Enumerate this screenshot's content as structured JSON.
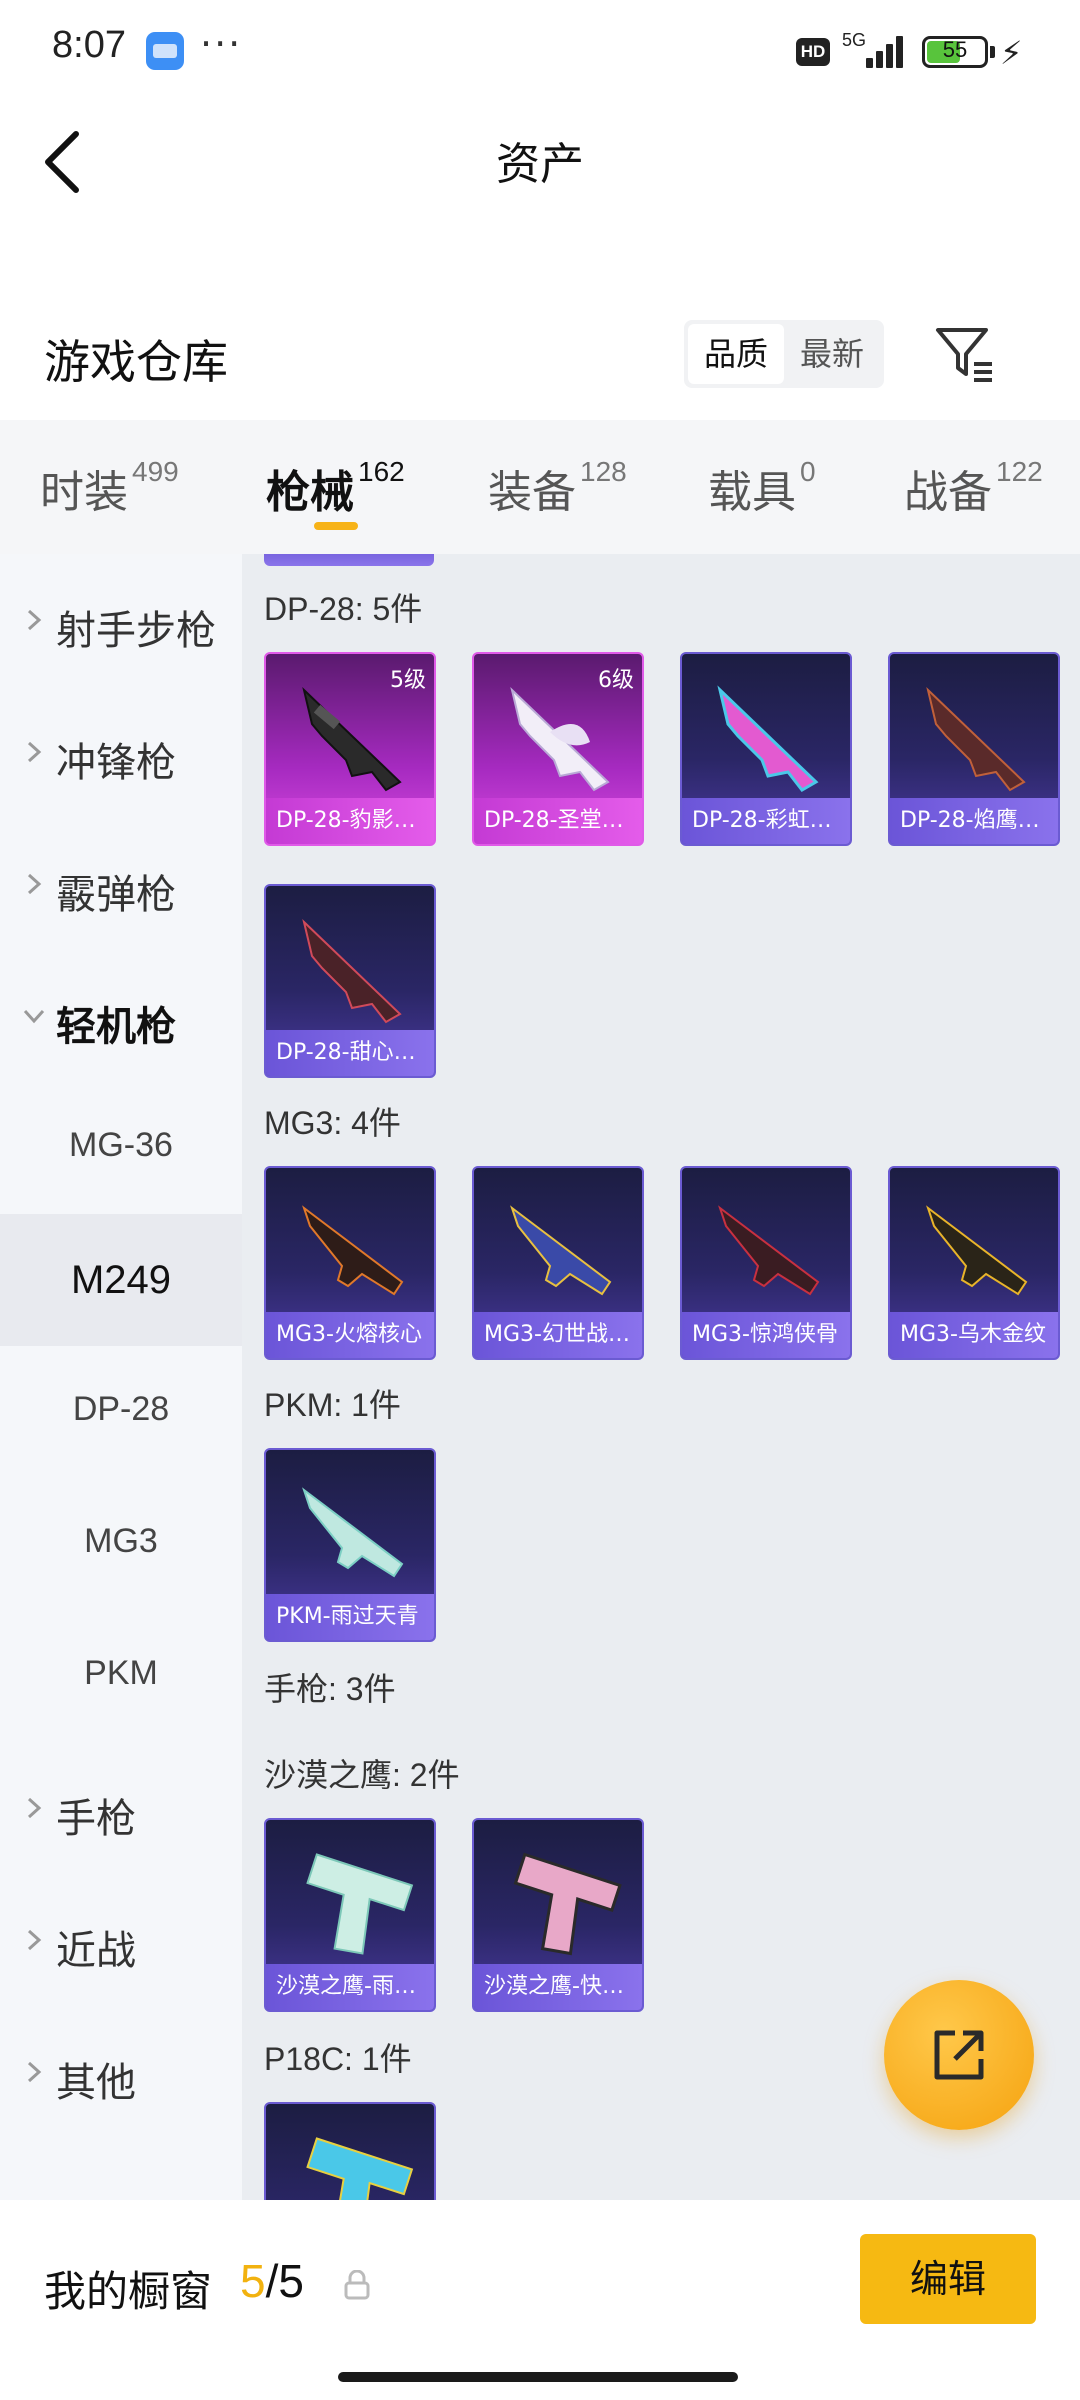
{
  "status_bar": {
    "time": "8:07",
    "dots": "···",
    "hd": "HD",
    "network": "5G",
    "battery": "55"
  },
  "header": {
    "title": "资产"
  },
  "section": {
    "title": "游戏仓库",
    "sort_quality": "品质",
    "sort_newest": "最新"
  },
  "category_tabs": [
    {
      "label": "时装",
      "count": "499"
    },
    {
      "label": "枪械",
      "count": "162",
      "active": true
    },
    {
      "label": "装备",
      "count": "128"
    },
    {
      "label": "载具",
      "count": "0"
    },
    {
      "label": "战备",
      "count": "122"
    }
  ],
  "sidebar": {
    "items": [
      {
        "label": "射手步枪"
      },
      {
        "label": "冲锋枪"
      },
      {
        "label": "霰弹枪"
      },
      {
        "label": "轻机枪"
      },
      {
        "label": "MG-36"
      },
      {
        "label": "M249"
      },
      {
        "label": "DP-28"
      },
      {
        "label": "MG3"
      },
      {
        "label": "PKM"
      },
      {
        "label": "手枪"
      },
      {
        "label": "近战"
      },
      {
        "label": "其他"
      }
    ]
  },
  "groups": [
    {
      "title": "DP-28: 5件",
      "items": [
        {
          "name": "DP-28-豹影…",
          "level": "5级",
          "rarity": "magenta"
        },
        {
          "name": "DP-28-圣堂…",
          "level": "6级",
          "rarity": "magenta"
        },
        {
          "name": "DP-28-彩虹…",
          "rarity": "purple"
        },
        {
          "name": "DP-28-焰鹰…",
          "rarity": "purple"
        },
        {
          "name": "DP-28-甜心…",
          "rarity": "purple"
        }
      ]
    },
    {
      "title": "MG3: 4件",
      "items": [
        {
          "name": "MG3-火熔核心",
          "rarity": "purple"
        },
        {
          "name": "MG3-幻世战…",
          "rarity": "purple"
        },
        {
          "name": "MG3-惊鸿侠骨",
          "rarity": "purple"
        },
        {
          "name": "MG3-乌木金纹",
          "rarity": "purple"
        }
      ]
    },
    {
      "title": "PKM: 1件",
      "items": [
        {
          "name": "PKM-雨过天青",
          "rarity": "purple"
        }
      ]
    },
    {
      "title": "手枪: 3件",
      "items": []
    },
    {
      "title": "沙漠之鹰: 2件",
      "items": [
        {
          "name": "沙漠之鹰-雨…",
          "rarity": "purple"
        },
        {
          "name": "沙漠之鹰-快…",
          "rarity": "purple"
        }
      ]
    },
    {
      "title": "P18C: 1件",
      "items": []
    }
  ],
  "bottom_bar": {
    "label": "我的橱窗",
    "count_current": "5",
    "count_total": "/5",
    "edit_label": "编辑"
  },
  "colors": {
    "accent": "#f6b912",
    "card_purple": "#6b55d8",
    "card_magenta": "#c43ad4"
  }
}
